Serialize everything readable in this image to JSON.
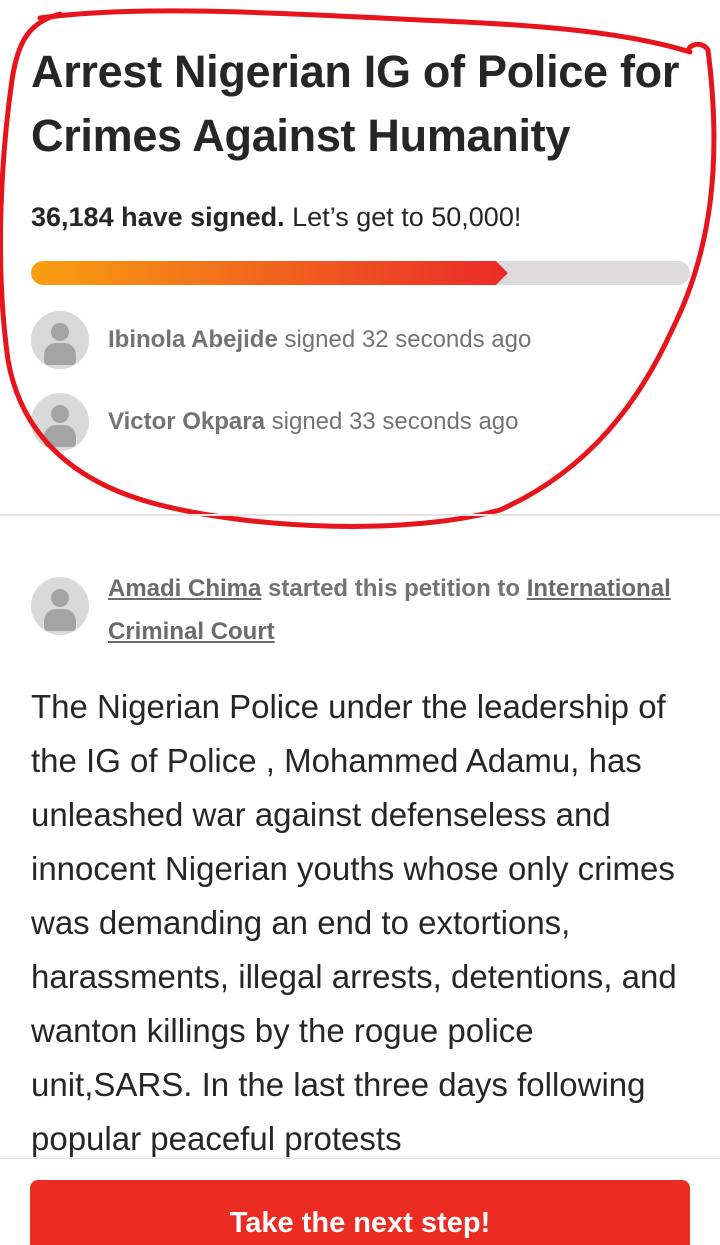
{
  "petition": {
    "title": "Arrest Nigerian IG of Police for Crimes Against Humanity",
    "signed_count_text": "36,184 have signed.",
    "goal_text": "Let’s get to 50,000!",
    "progress": 0.7237
  },
  "recent_signers": [
    {
      "name": "Ibinola Abejide",
      "action": "signed 32 seconds ago"
    },
    {
      "name": "Victor Okpara",
      "action": "signed 33 seconds ago"
    }
  ],
  "starter": {
    "name": "Amadi Chima",
    "middle_text": "started this petition to",
    "target": "International Criminal Court"
  },
  "body_text": "The Nigerian Police under the leadership of the IG of Police , Mohammed Adamu, has unleashed  war against defenseless and innocent Nigerian youths whose only crimes was demanding an end to extortions, harassments, illegal arrests, detentions, and wanton killings by the rogue police unit,SARS. In the last three days following popular peaceful protests",
  "cta": {
    "label": "Take the next step!"
  },
  "colors": {
    "accent": "#ec2c22",
    "progress_start": "#f99f10",
    "progress_end": "#eb2a2a",
    "annotation": "#e8141c"
  }
}
